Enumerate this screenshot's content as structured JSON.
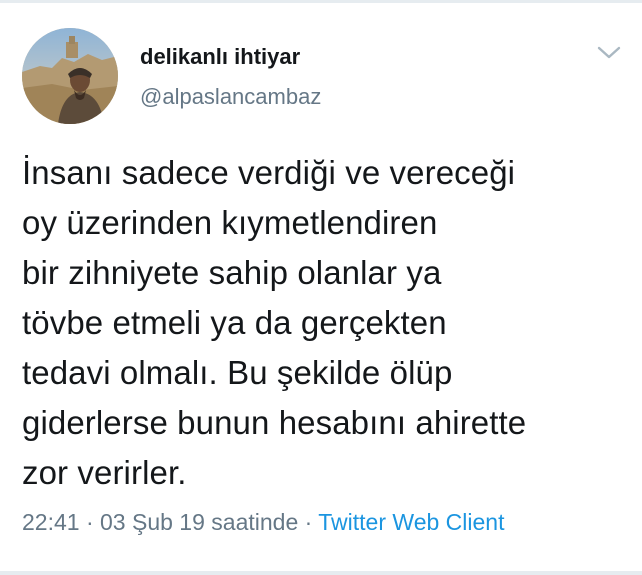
{
  "user": {
    "display_name": "delikanlı ihtiyar",
    "handle": "@alpaslancambaz"
  },
  "tweet": {
    "lines": [
      "İnsanı sadece verdiği ve vereceği",
      "oy üzerinden kıymetlendiren",
      "bir zihniyete sahip olanlar ya",
      "tövbe etmeli ya da gerçekten",
      "tedavi olmalı. Bu şekilde ölüp",
      "giderlerse bunun hesabını ahirette",
      "zor verirler."
    ],
    "time": "22:41",
    "date": "03 Şub 19 saatinde",
    "separator": "·",
    "source": "Twitter Web Client"
  },
  "icons": {
    "menu": "chevron-down-icon",
    "avatar": "profile-photo"
  },
  "colors": {
    "text_primary": "#14171a",
    "text_secondary": "#657786",
    "link": "#1b95e0",
    "divider": "#e6ecf0"
  }
}
